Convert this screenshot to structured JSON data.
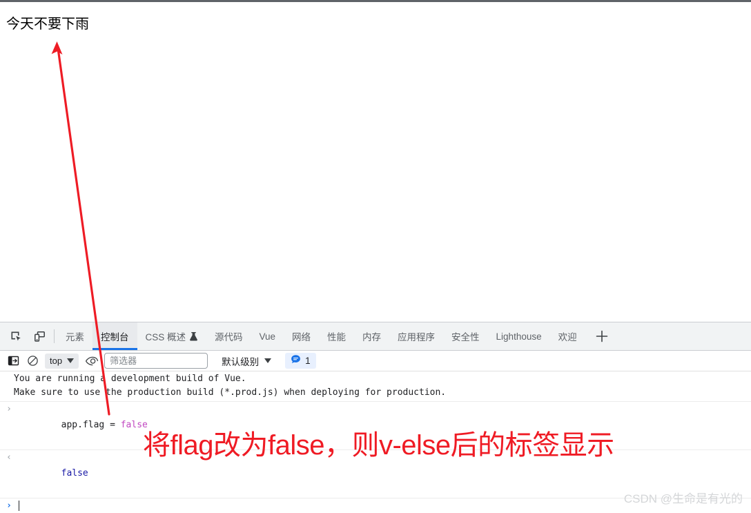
{
  "page": {
    "heading": "今天不要下雨"
  },
  "devtools": {
    "left_tools": [
      {
        "name": "inspect-element-icon",
        "label": "检查元素"
      },
      {
        "name": "device-toolbar-icon",
        "label": "切换设备工具栏"
      }
    ],
    "tabs": [
      {
        "label": "元素",
        "selected": false,
        "icon": ""
      },
      {
        "label": "控制台",
        "selected": true,
        "icon": ""
      },
      {
        "label": "CSS 概述",
        "selected": false,
        "icon": "flask-icon"
      },
      {
        "label": "源代码",
        "selected": false,
        "icon": ""
      },
      {
        "label": "Vue",
        "selected": false,
        "icon": ""
      },
      {
        "label": "网络",
        "selected": false,
        "icon": ""
      },
      {
        "label": "性能",
        "selected": false,
        "icon": ""
      },
      {
        "label": "内存",
        "selected": false,
        "icon": ""
      },
      {
        "label": "应用程序",
        "selected": false,
        "icon": ""
      },
      {
        "label": "安全性",
        "selected": false,
        "icon": ""
      },
      {
        "label": "Lighthouse",
        "selected": false,
        "icon": ""
      },
      {
        "label": "欢迎",
        "selected": false,
        "icon": ""
      }
    ],
    "add_tab_label": "+",
    "selected_tab_accent": "#1a73e8"
  },
  "console_toolbar": {
    "sidebar_toggle": "显示控制台侧边栏",
    "clear_console": "清除控制台",
    "context": "top",
    "eye_label": "实时表达式",
    "filter": {
      "value": "",
      "placeholder": "筛选器"
    },
    "level": "默认级别",
    "message_count": "1"
  },
  "console_messages": [
    {
      "type": "warning",
      "gutter": "",
      "lines": [
        "You are running a development build of Vue.",
        "Make sure to use the production build (*.prod.js) when deploying for production."
      ]
    },
    {
      "type": "input",
      "gutter": "›",
      "tokens": [
        {
          "text": "app.flag = ",
          "style": "plain"
        },
        {
          "text": "false",
          "style": "keyword"
        }
      ]
    },
    {
      "type": "output",
      "gutter": "‹",
      "tokens": [
        {
          "text": "false",
          "style": "bool"
        }
      ]
    }
  ],
  "prompt": {
    "gutter": "›",
    "value": ""
  },
  "annotations": {
    "red_text": "将flag改为false，则v-else后的标签显示",
    "arrow_color": "#ee1c25"
  },
  "watermark": {
    "text": "CSDN @生命是有光的"
  }
}
